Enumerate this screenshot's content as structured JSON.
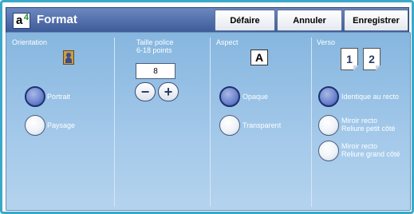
{
  "window": {
    "title": "Format",
    "icon": "format-app-icon",
    "icon_letter": "a",
    "icon_number": "4"
  },
  "toolbar": {
    "undo_label": "Défaire",
    "cancel_label": "Annuler",
    "save_label": "Enregistrer"
  },
  "orientation": {
    "label": "Orientation",
    "icon": "portrait-icon",
    "options": [
      {
        "label": "Portrait",
        "selected": true
      },
      {
        "label": "Paysage",
        "selected": false
      }
    ]
  },
  "font_size": {
    "label": "Taille police",
    "range": "6-18 points",
    "value": "8",
    "decrement": "−",
    "increment": "+"
  },
  "aspect": {
    "label": "Aspect",
    "icon_letter": "A",
    "options": [
      {
        "label": "Opaque",
        "selected": true
      },
      {
        "label": "Transparent",
        "selected": false
      }
    ]
  },
  "verso": {
    "label": "Verso",
    "pages": [
      "1",
      "2"
    ],
    "options": [
      {
        "label": "Identique au recto",
        "selected": true
      },
      {
        "label_line1": "Miroir recto",
        "label_line2": "Reliure petit côté",
        "selected": false
      },
      {
        "label_line1": "Miroir recto",
        "label_line2": "Reliure grand côté",
        "selected": false
      }
    ]
  },
  "colors": {
    "frame": "#3aa9c9",
    "titlebar": "#3d5b98",
    "panel": "#a4c9ea",
    "selected_radio": "#3b55a5"
  }
}
